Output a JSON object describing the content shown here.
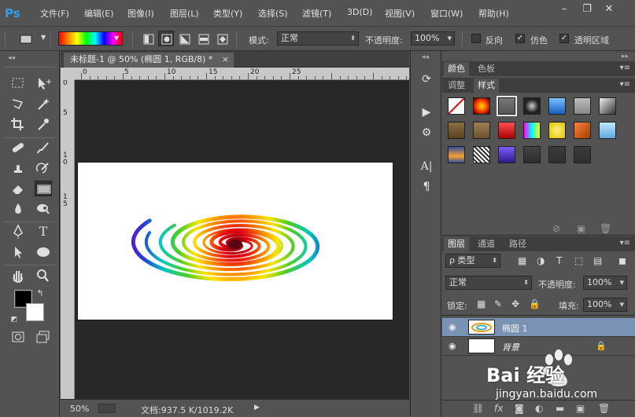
{
  "app": {
    "logo": "Ps"
  },
  "menu": [
    "文件(F)",
    "编辑(E)",
    "图像(I)",
    "图层(L)",
    "类型(Y)",
    "选择(S)",
    "滤镜(T)",
    "3D(D)",
    "视图(V)",
    "窗口(W)",
    "帮助(H)"
  ],
  "window_controls": {
    "minimize": "–",
    "restore": "❐",
    "close": "✕"
  },
  "options": {
    "mode_label": "模式:",
    "mode_value": "正常",
    "opacity_label": "不透明度:",
    "opacity_value": "100%",
    "reverse_label": "反向",
    "dither_label": "仿色",
    "transparency_label": "透明区域",
    "reverse_checked": false,
    "dither_checked": true,
    "transparency_checked": true
  },
  "document": {
    "tab_title": "未标题-1 @ 50% (椭圆 1, RGB/8) *",
    "ruler_h_numbers": [
      "0",
      "5",
      "10",
      "15",
      "20",
      "25"
    ],
    "ruler_v_numbers": [
      "0",
      "5",
      "1 0",
      "1 5"
    ]
  },
  "status": {
    "zoom": "50%",
    "doc_info": "文档:937.5 K/1019.2K"
  },
  "panels": {
    "top_tabs_row1": [
      "颜色",
      "色板"
    ],
    "top_tabs_row2": [
      "调整",
      "样式"
    ],
    "layers_tabs": [
      "图层",
      "通道",
      "路径"
    ],
    "kind_filter": "ρ 类型",
    "blend_mode": "正常",
    "opacity_label": "不透明度:",
    "opacity_value": "100%",
    "lock_label": "锁定:",
    "fill_label": "填充:",
    "fill_value": "100%",
    "layers": [
      {
        "name": "椭圆 1",
        "selected": true
      },
      {
        "name": "背景",
        "selected": false
      }
    ]
  },
  "colors": {
    "accent_blue": "#2c9fe8",
    "selected_layer": "#7a93b5",
    "foreground": "#000000",
    "background": "#ffffff"
  },
  "watermark": {
    "brand": "Bai 经验",
    "url": "jingyan.baidu.com"
  }
}
